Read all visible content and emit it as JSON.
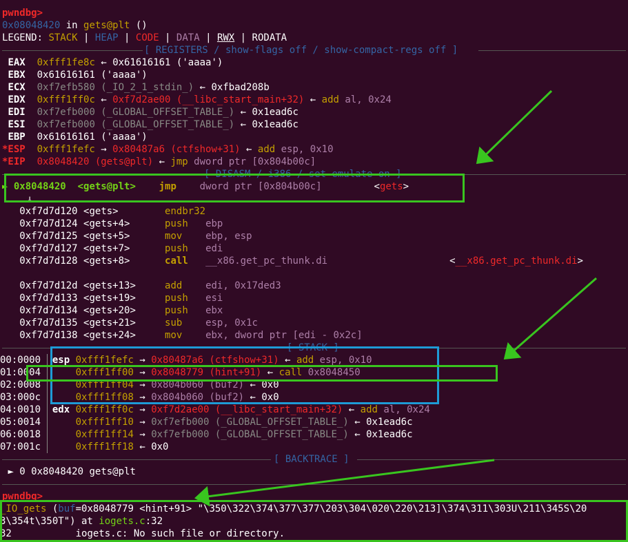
{
  "prompt": "pwndbg>",
  "loc": {
    "addr": "0x08048420",
    "in": " in ",
    "sym": "gets@plt",
    "rest": " ()"
  },
  "legend": {
    "label": "LEGEND: ",
    "stack": "STACK",
    "heap": "HEAP",
    "code": "CODE",
    "data": "DATA",
    "rwx": "RWX",
    "rodata": "RODATA",
    "sep": " | "
  },
  "headers": {
    "registers": "[ REGISTERS / show-flags off / show-compact-regs off ]",
    "disasm": "[ DISASM / i386 / set emulate on ]",
    "stack": "[ STACK ]",
    "backtrace": "[ BACKTRACE ]"
  },
  "registers": [
    {
      "name": "EAX",
      "val": "0xfff1fe8c",
      "arrow": " ← ",
      "deref": "0x61616161 ('aaaa')"
    },
    {
      "name": "EBX",
      "val": "0x61616161 ('aaaa')"
    },
    {
      "name": "ECX",
      "val": "0xf7efb580 (_IO_2_1_stdin_)",
      "arrow": " ← ",
      "deref": "0xfbad208b"
    },
    {
      "name": "EDX",
      "val": "0xfff1ff0c",
      "arrow": " ← ",
      "deref": "0xf7d2ae00 (__libc_start_main+32)",
      "arrow2": " ← ",
      "ins": "add",
      "ops": " al, ",
      "num": "0x24"
    },
    {
      "name": "EDI",
      "val": "0xf7efb000 (_GLOBAL_OFFSET_TABLE_)",
      "arrow": " ← ",
      "deref": "0x1ead6c"
    },
    {
      "name": "ESI",
      "val": "0xf7efb000 (_GLOBAL_OFFSET_TABLE_)",
      "arrow": " ← ",
      "deref": "0x1ead6c"
    },
    {
      "name": "EBP",
      "val": "0x61616161 ('aaaa')"
    },
    {
      "name": "*ESP",
      "val": "0xfff1fefc",
      "arrow": " → ",
      "deref": "0x80487a6 (ctfshow+31)",
      "arrow2": " ← ",
      "ins": "add",
      "ops": " esp, ",
      "num": "0x10"
    },
    {
      "name": "*EIP",
      "val": "0x8048420 (gets@plt)",
      "arrow": " ← ",
      "ins": "jmp",
      "ops": " dword ptr [0x804b00c]"
    }
  ],
  "disasm_current": {
    "marker": "►",
    "addr": "0x8048420",
    "sym": "<gets@plt>",
    "ins": "jmp",
    "ops": "dword ptr [0x804b00c]",
    "target_l": "<",
    "target": "gets",
    "target_r": ">",
    "down": "↓"
  },
  "disasm": [
    {
      "addr": "0xf7d7d120",
      "sym": "<gets>",
      "ins": "endbr32",
      "ops": ""
    },
    {
      "addr": "0xf7d7d124",
      "sym": "<gets+4>",
      "ins": "push",
      "ops": "ebp"
    },
    {
      "addr": "0xf7d7d125",
      "sym": "<gets+5>",
      "ins": "mov",
      "ops": "ebp, esp"
    },
    {
      "addr": "0xf7d7d127",
      "sym": "<gets+7>",
      "ins": "push",
      "ops": "edi"
    },
    {
      "addr": "0xf7d7d128",
      "sym": "<gets+8>",
      "ins": "call",
      "ops": "__x86.get_pc_thunk.di",
      "target_l": "<",
      "target": "__x86.get_pc_thunk.di",
      "target_r": ">"
    },
    {
      "addr": "0xf7d7d12d",
      "sym": "<gets+13>",
      "ins": "add",
      "ops": "edi, ",
      "num": "0x17ded3"
    },
    {
      "addr": "0xf7d7d133",
      "sym": "<gets+19>",
      "ins": "push",
      "ops": "esi"
    },
    {
      "addr": "0xf7d7d134",
      "sym": "<gets+20>",
      "ins": "push",
      "ops": "ebx"
    },
    {
      "addr": "0xf7d7d135",
      "sym": "<gets+21>",
      "ins": "sub",
      "ops": "esp, ",
      "num": "0x1c"
    },
    {
      "addr": "0xf7d7d138",
      "sym": "<gets+24>",
      "ins": "mov",
      "ops": "ebx, dword ptr [edi - ",
      "num": "0x2c",
      "ops2": "]"
    }
  ],
  "stack": [
    {
      "off": "00:0000",
      "reg": "esp",
      "addr": "0xfff1fefc",
      "arrow": " → ",
      "ptr": "0x80487a6 (ctfshow+31)",
      "arrow2": " ← ",
      "ins": "add",
      "ops": " esp, ",
      "num": "0x10"
    },
    {
      "off": "01:0004",
      "reg": "",
      "addr": "0xfff1ff00",
      "arrow": " → ",
      "ptr": "0x8048779 (hint+91)",
      "arrow2": " ← ",
      "ins": "call",
      "ops": " 0x8048450"
    },
    {
      "off": "02:0008",
      "reg": "",
      "addr": "0xfff1ff04",
      "arrow": " → ",
      "ptr": "0x804b060 (buf2)",
      "arrow2": " ← ",
      "tail": "0x0"
    },
    {
      "off": "03:000c",
      "reg": "",
      "addr": "0xfff1ff08",
      "arrow": " → ",
      "ptr": "0x804b060 (buf2)",
      "arrow2": " ← ",
      "tail": "0x0"
    },
    {
      "off": "04:0010",
      "reg": "edx",
      "addr": "0xfff1ff0c",
      "arrow": " → ",
      "ptr": "0xf7d2ae00 (__libc_start_main+32)",
      "arrow2": " ← ",
      "ins": "add",
      "ops": " al, ",
      "num": "0x24"
    },
    {
      "off": "05:0014",
      "reg": "",
      "addr": "0xfff1ff10",
      "arrow": " → ",
      "ptr": "0xf7efb000 (_GLOBAL_OFFSET_TABLE_)",
      "arrow2": " ← ",
      "tail": "0x1ead6c"
    },
    {
      "off": "06:0018",
      "reg": "",
      "addr": "0xfff1ff14",
      "arrow": " → ",
      "ptr": "0xf7efb000 (_GLOBAL_OFFSET_TABLE_)",
      "arrow2": " ← ",
      "tail": "0x1ead6c"
    },
    {
      "off": "07:001c",
      "reg": "",
      "addr": "0xfff1ff18",
      "arrow": " ← ",
      "tail": "0x0"
    }
  ],
  "backtrace": {
    "marker": "►",
    "frame": " 0 ",
    "addr": "0x8048420",
    "sym": " gets@plt"
  },
  "output": {
    "fn": "_IO_gets",
    "args_a": " (",
    "param": "buf",
    "args_b": "=0x8048779 <hint+91> \"\\350\\322\\374\\377\\377\\203\\304\\020\\220\\213]\\374\\311\\303U\\211\\345S\\20",
    "line2_a": "3\\354t\\350T\") at ",
    "file": "iogets.c",
    "line2_b": ":32",
    "line3": "32\t     iogets.c: No such file or directory."
  }
}
